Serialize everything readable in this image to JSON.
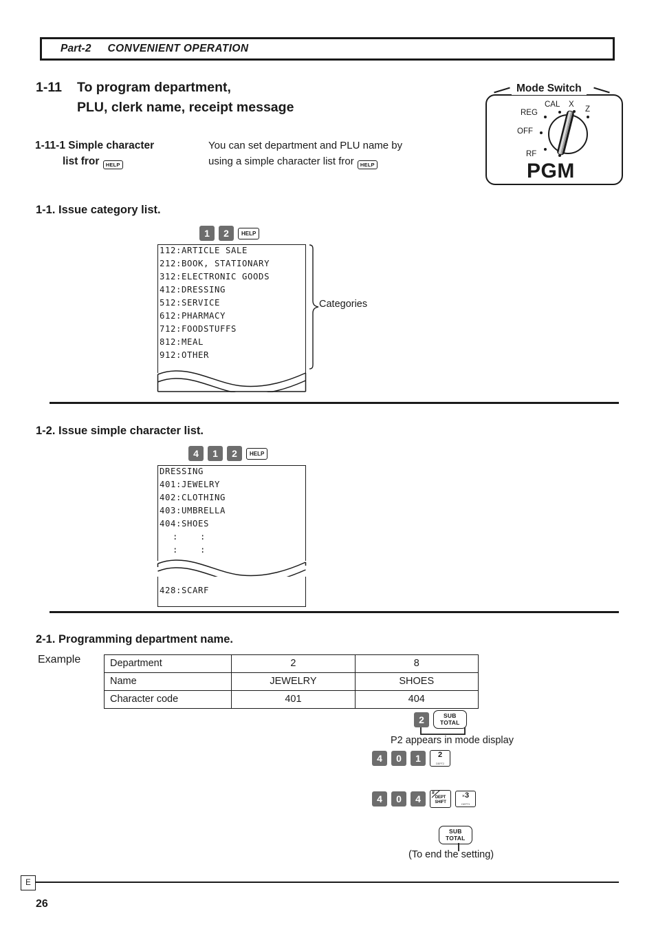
{
  "banner": {
    "part": "Part-2",
    "chapter_title": "CONVENIENT OPERATION"
  },
  "section": {
    "number": "1-11",
    "title_line1": "To program department,",
    "title_line2": "PLU, clerk name, receipt message"
  },
  "subsection": {
    "heading_line1": "1-11-1 Simple character",
    "heading_line2": "list fror",
    "heading_key": "HELP",
    "body_line1": "You can set department and PLU name by",
    "body_line2": "using a simple character list fror",
    "body_key": "HELP"
  },
  "mode_switch": {
    "label": "Mode Switch",
    "positions": [
      "CAL",
      "X",
      "Z",
      "REG",
      "OFF",
      "RF"
    ],
    "selected": "PGM",
    "selected_label": "PGM"
  },
  "step_1_1": {
    "heading": "1-1.  Issue category list.",
    "keys": [
      "1",
      "2"
    ],
    "help_key": "HELP",
    "receipt_lines": [
      "112:ARTICLE SALE",
      "212:BOOK, STATIONARY",
      "312:ELECTRONIC GOODS",
      "412:DRESSING",
      "512:SERVICE",
      "612:PHARMACY",
      "712:FOODSTUFFS",
      "812:MEAL",
      "912:OTHER"
    ],
    "brace_label": "Categories"
  },
  "step_1_2": {
    "heading": "1-2.  Issue simple character list.",
    "keys": [
      "4",
      "1",
      "2"
    ],
    "help_key": "HELP",
    "receipt_lines_top": [
      "DRESSING",
      "401:JEWELRY",
      "402:CLOTHING",
      "403:UMBRELLA",
      "404:SHOES",
      " :    :",
      " :    :"
    ],
    "receipt_lines_bottom": [
      "428:SCARF"
    ]
  },
  "step_2_1": {
    "heading": "2-1.  Programming department name.",
    "example_label": "Example",
    "table": {
      "rows": [
        {
          "label": "Department",
          "col1": "2",
          "col2": "8"
        },
        {
          "label": "Name",
          "col1": "JEWELRY",
          "col2": "SHOES"
        },
        {
          "label": "Character code",
          "col1": "401",
          "col2": "404"
        }
      ]
    },
    "sequence_1": {
      "num_key": "2",
      "subtotal_key_line1": "SUB",
      "subtotal_key_line2": "TOTAL",
      "caption": "P2 appears in mode display"
    },
    "sequence_2": {
      "num_keys": [
        "4",
        "0",
        "1"
      ],
      "dept_key_main": "2",
      "dept_key_sub": "DEPT2"
    },
    "sequence_3": {
      "num_keys": [
        "4",
        "0",
        "4"
      ],
      "shift_key_hash": "#",
      "shift_key_line1": "DEPT",
      "shift_key_line2": "SHIFT",
      "mult_key_main": "3",
      "mult_key_prefix": "×",
      "mult_key_sub": "DEPT3"
    },
    "sequence_4": {
      "subtotal_key_line1": "SUB",
      "subtotal_key_line2": "TOTAL",
      "caption": "(To end the setting)"
    }
  },
  "footer": {
    "mark": "E",
    "page_number": "26"
  }
}
